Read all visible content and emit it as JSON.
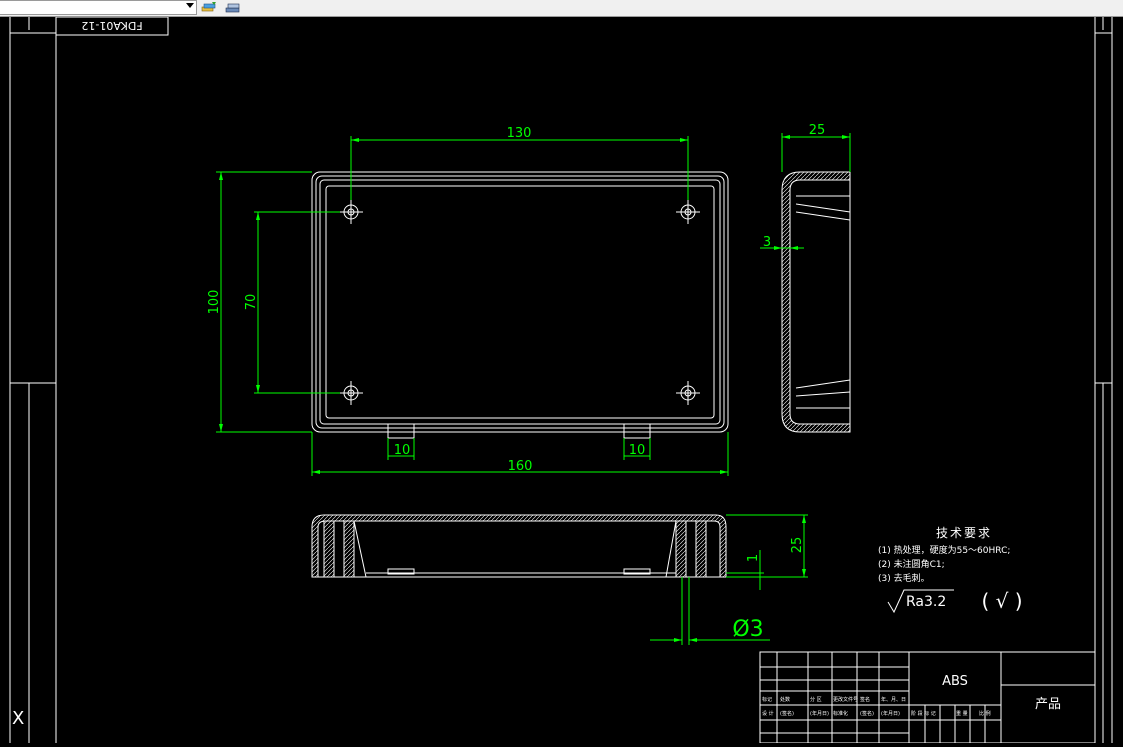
{
  "toolbar": {
    "layer_combo_value": "",
    "icons": [
      "layer-states-icon",
      "layer-properties-icon"
    ]
  },
  "drawing": {
    "drawing_number": "FDKA01-12",
    "material": "ABS",
    "product_label": "产品",
    "title_block_headers": [
      "标记",
      "处数",
      "分 区",
      "更改文件号",
      "签名",
      "年、月、日"
    ],
    "title_block_row2": [
      "设 计",
      "(签名)",
      "(年月日)",
      "标准化",
      "(签名)",
      "(年月日)"
    ],
    "title_block_stage": [
      "阶 段 标 记",
      "重 量",
      "比 例"
    ],
    "dimensions": {
      "width_total": "130",
      "length_total": "160",
      "height_total": "100",
      "hole_spacing": "70",
      "clip_width_left": "10",
      "clip_width_right": "10",
      "side_depth": "25",
      "wall_thickness": "3",
      "section_height": "25",
      "step": "1",
      "hole_diameter": "Ø3"
    },
    "tech_requirements": {
      "title": "技术要求",
      "items": [
        "(1) 热处理，硬度为55～60HRC;",
        "(2) 未注圆角C1;",
        "(3) 去毛刺。"
      ],
      "roughness": "Ra3.2",
      "roughness_other": "( √ )"
    },
    "ucs_axis": "X"
  },
  "colors": {
    "background": "#000000",
    "geometry": "#ffffff",
    "dimension": "#00ff00",
    "text": "#ffffff"
  }
}
